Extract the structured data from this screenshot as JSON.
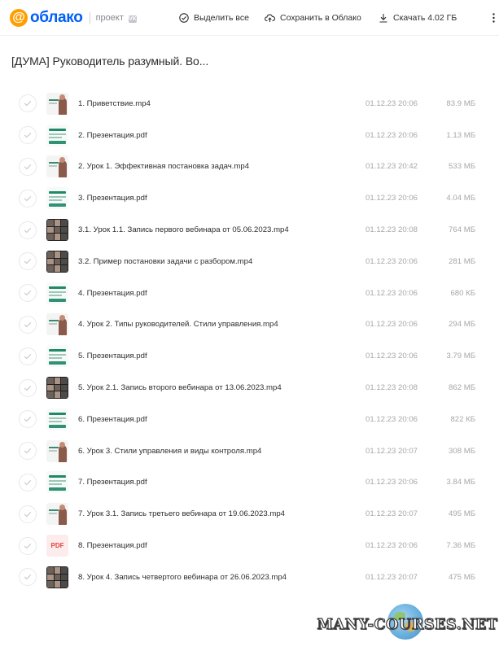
{
  "header": {
    "logo_symbol": "@",
    "logo_text": "облако",
    "project_label": "проект",
    "project_badge": "VK",
    "actions": {
      "select_all": "Выделить все",
      "save": "Сохранить в Облако",
      "download": "Скачать 4.02 ГБ"
    }
  },
  "folder_title": "[ДУМА] Руководитель разумный. Во...",
  "files": [
    {
      "name": "1. Приветствие.mp4",
      "date": "01.12.23 20:06",
      "size": "83.9 МБ",
      "thumb": "lesson"
    },
    {
      "name": "2. Презентация.pdf",
      "date": "01.12.23 20:06",
      "size": "1.13 МБ",
      "thumb": "slide"
    },
    {
      "name": "2. Урок 1. Эффективная постановка задач.mp4",
      "date": "01.12.23 20:42",
      "size": "533 МБ",
      "thumb": "lesson"
    },
    {
      "name": "3. Презентация.pdf",
      "date": "01.12.23 20:06",
      "size": "4.04 МБ",
      "thumb": "slide"
    },
    {
      "name": "3.1. Урок 1.1. Запись первого вебинара от 05.06.2023.mp4",
      "date": "01.12.23 20:08",
      "size": "764 МБ",
      "thumb": "grid"
    },
    {
      "name": "3.2. Пример постановки задачи с разбором.mp4",
      "date": "01.12.23 20:06",
      "size": "281 МБ",
      "thumb": "grid"
    },
    {
      "name": "4. Презентация.pdf",
      "date": "01.12.23 20:06",
      "size": "680 КБ",
      "thumb": "slide"
    },
    {
      "name": "4. Урок 2. Типы руководителей. Стили управления.mp4",
      "date": "01.12.23 20:06",
      "size": "294 МБ",
      "thumb": "lesson"
    },
    {
      "name": "5. Презентация.pdf",
      "date": "01.12.23 20:06",
      "size": "3.79 МБ",
      "thumb": "slide"
    },
    {
      "name": "5. Урок 2.1. Запись второго вебинара от 13.06.2023.mp4",
      "date": "01.12.23 20:08",
      "size": "862 МБ",
      "thumb": "grid"
    },
    {
      "name": "6. Презентация.pdf",
      "date": "01.12.23 20:06",
      "size": "822 КБ",
      "thumb": "slide"
    },
    {
      "name": "6. Урок 3. Стили управления и виды контроля.mp4",
      "date": "01.12.23 20:07",
      "size": "308 МБ",
      "thumb": "lesson"
    },
    {
      "name": "7. Презентация.pdf",
      "date": "01.12.23 20:06",
      "size": "3.84 МБ",
      "thumb": "slide"
    },
    {
      "name": "7. Урок 3.1. Запись третьего вебинара от 19.06.2023.mp4",
      "date": "01.12.23 20:07",
      "size": "495 МБ",
      "thumb": "lesson"
    },
    {
      "name": "8. Презентация.pdf",
      "date": "01.12.23 20:06",
      "size": "7.36 МБ",
      "thumb": "pdf",
      "thumb_label": "PDF"
    },
    {
      "name": "8. Урок 4. Запись четвертого вебинара от 26.06.2023.mp4",
      "date": "01.12.23 20:07",
      "size": "475 МБ",
      "thumb": "grid"
    }
  ],
  "watermark": "MANY-COURSES.NET",
  "colors": {
    "brand_blue": "#005ff9",
    "brand_orange": "#ff9e00",
    "text": "#2c2d2e",
    "muted": "#a5a7ab",
    "pdf_red": "#e5433c"
  }
}
